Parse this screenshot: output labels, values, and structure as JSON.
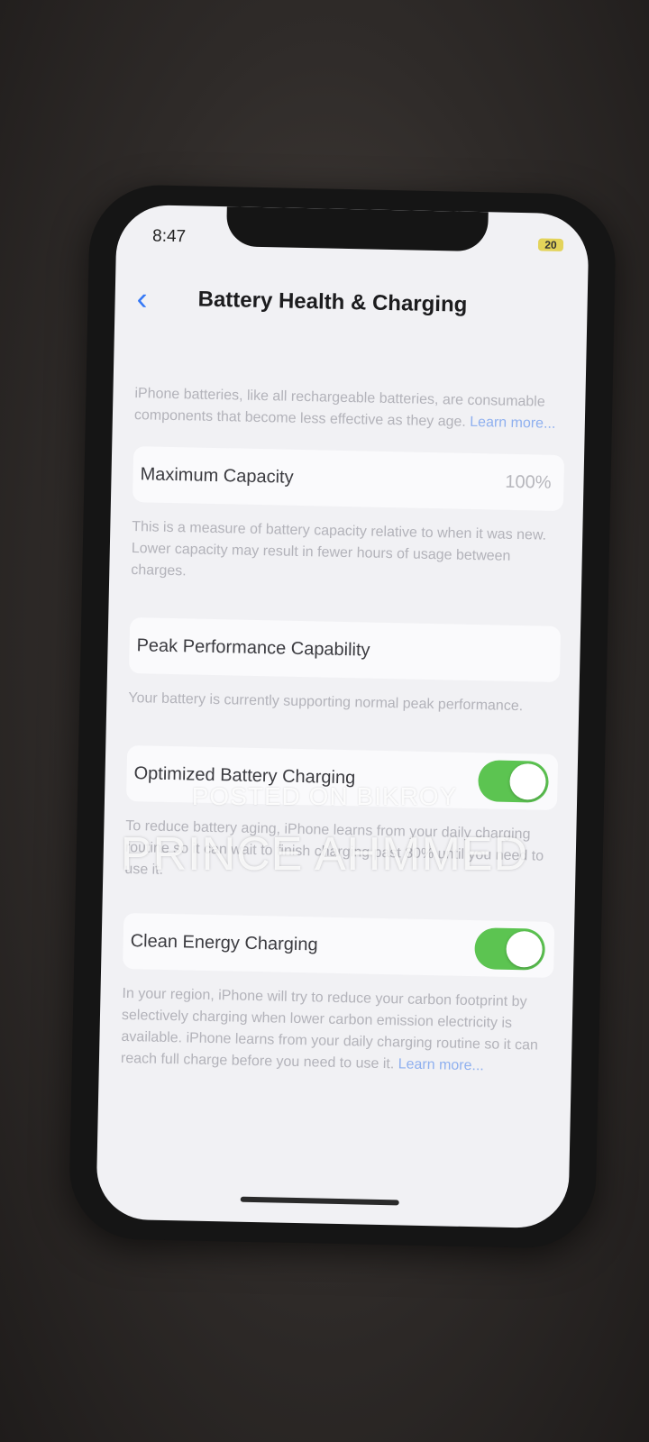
{
  "status_bar": {
    "time": "8:47",
    "battery": "20"
  },
  "header": {
    "back_icon": "chevron-left-icon",
    "title": "Battery Health & Charging"
  },
  "intro": {
    "text": "iPhone batteries, like all rechargeable batteries, are consumable components that become less effective as they age.",
    "link": "Learn more..."
  },
  "maximum_capacity": {
    "label": "Maximum Capacity",
    "value": "100%",
    "description": "This is a measure of battery capacity relative to when it was new. Lower capacity may result in fewer hours of usage between charges."
  },
  "peak_performance": {
    "label": "Peak Performance Capability",
    "description": "Your battery is currently supporting normal peak performance."
  },
  "optimized_charging": {
    "label": "Optimized Battery Charging",
    "enabled": true,
    "description": "To reduce battery aging, iPhone learns from your daily charging routine so it can wait to finish charging past 80% until you need to use it."
  },
  "clean_energy_charging": {
    "label": "Clean Energy Charging",
    "enabled": true,
    "description": "In your region, iPhone will try to reduce your carbon footprint by selectively charging when lower carbon emission electricity is available. iPhone learns from your daily charging routine so it can reach full charge before you need to use it.",
    "link": "Learn more..."
  },
  "watermark": {
    "line1": "POSTED ON BIKROY",
    "line2": "PRINCE AHMMED"
  },
  "colors": {
    "accent": "#3478f6",
    "toggle_on": "#5cc451",
    "background": "#f1f1f4"
  }
}
